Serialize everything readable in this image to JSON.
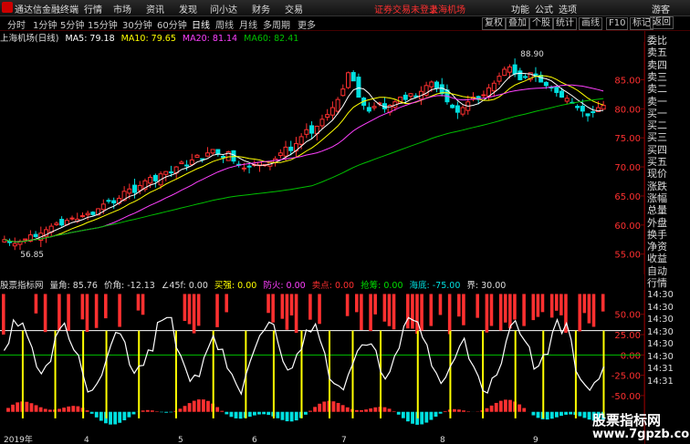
{
  "titlebar": {
    "app_name": "通达信金融终端",
    "menu": [
      "行情",
      "市场",
      "资讯",
      "发现",
      "问小达",
      "财务",
      "交易"
    ],
    "status": "证券交易未登录",
    "stock": "上海机场",
    "right": [
      "功能",
      "公式",
      "选项"
    ],
    "user": "游客"
  },
  "periods": [
    "分时",
    "1分钟",
    "5分钟",
    "15分钟",
    "30分钟",
    "60分钟",
    "日线",
    "周线",
    "月线",
    "多周期",
    "更多"
  ],
  "active_period": "日线",
  "right_tabs": [
    "复权",
    "叠加",
    "个股",
    "统计",
    "画线",
    "F10",
    "标记"
  ],
  "back_label": "返回",
  "chart_header": {
    "name": "上海机场(日线)",
    "ma5": "MA5: 79.18",
    "ma10": "MA10: 79.65",
    "ma20": "MA20: 81.14",
    "ma60": "MA60: 82.41"
  },
  "indicator_header": {
    "name": "股票指标网",
    "items": [
      "量角: 85.76",
      "价角: -12.13",
      "∠45f: 0.00",
      "买强: 0.00",
      "防火: 0.00",
      "卖点: 0.00",
      "抢筹: 0.00",
      "海底: -75.00",
      "界: 30.00"
    ]
  },
  "right_panel": [
    "委比",
    "卖五",
    "卖四",
    "卖三",
    "卖二",
    "卖一",
    "买一",
    "买二",
    "买三",
    "买四",
    "买五",
    "现价",
    "涨跌",
    "涨幅",
    "总量",
    "外盘",
    "换手",
    "净资",
    "收益",
    "自动",
    "行情"
  ],
  "time_rows": [
    "14:30",
    "14:30",
    "14:30",
    "14:30",
    "14:30",
    "14:30",
    "14:31",
    "14:31"
  ],
  "colors": {
    "up": "#ff3030",
    "down": "#00e0e0",
    "ma5": "#ffffff",
    "ma10": "#ffff00",
    "ma20": "#ff40ff",
    "ma60": "#00c000",
    "line": "#ffffff",
    "marker": "#ffff00",
    "bg": "#000000",
    "axis": "#800000"
  },
  "watermark": {
    "cn": "股票指标网",
    "url": "www.7gpzb.com"
  },
  "chart_data": [
    {
      "type": "candlestick",
      "title": "上海机场(日线)",
      "y_ticks": [
        85.0,
        80.0,
        75.0,
        70.0,
        65.0,
        60.0,
        55.0
      ],
      "ylim": [
        51.5,
        91.5
      ],
      "x_ticks": [
        "2019年",
        "4",
        "5",
        "6",
        "7",
        "8",
        "9"
      ],
      "annotations": [
        "88.90",
        "56.85"
      ],
      "series": [
        {
          "name": "MA5"
        },
        {
          "name": "MA10"
        },
        {
          "name": "MA20"
        },
        {
          "name": "MA60"
        }
      ],
      "closes": [
        57.5,
        57.0,
        56.8,
        57.2,
        57.6,
        58.3,
        58.0,
        58.6,
        59.2,
        59.8,
        60.3,
        60.0,
        60.8,
        61.2,
        61.0,
        61.6,
        62.0,
        61.8,
        62.8,
        63.6,
        64.2,
        63.8,
        64.6,
        65.8,
        66.2,
        65.6,
        66.8,
        67.6,
        68.2,
        67.6,
        68.8,
        69.2,
        69.0,
        70.0,
        70.8,
        70.2,
        71.2,
        72.0,
        71.4,
        72.4,
        73.0,
        72.2,
        71.6,
        72.6,
        71.0,
        70.4,
        69.8,
        70.0,
        70.4,
        70.8,
        70.4,
        70.8,
        71.4,
        72.4,
        73.4,
        72.8,
        74.0,
        75.2,
        76.4,
        75.8,
        77.0,
        78.2,
        79.0,
        80.2,
        81.6,
        83.4,
        86.2,
        84.8,
        82.0,
        80.6,
        79.6,
        80.4,
        81.0,
        80.0,
        80.6,
        81.2,
        82.0,
        81.6,
        82.6,
        82.2,
        83.0,
        84.0,
        84.6,
        83.6,
        82.6,
        81.2,
        80.2,
        79.4,
        80.2,
        81.2,
        82.0,
        81.6,
        82.4,
        83.6,
        84.4,
        85.6,
        86.8,
        87.2,
        86.0,
        85.0,
        85.4,
        86.2,
        85.6,
        84.6,
        84.0,
        83.6,
        82.8,
        82.0,
        81.8,
        81.0,
        80.2,
        79.6,
        78.8,
        79.4,
        80.2,
        80.6
      ]
    },
    {
      "type": "indicator",
      "title": "股票指标网",
      "y_ticks": [
        50.0,
        25.0,
        0.0,
        -25.0,
        -50.0
      ],
      "ylim": [
        -95,
        80
      ],
      "x_ticks": [
        "2019年",
        "4",
        "5",
        "6",
        "7",
        "8",
        "9"
      ],
      "thresholds": [
        30,
        0
      ]
    }
  ]
}
